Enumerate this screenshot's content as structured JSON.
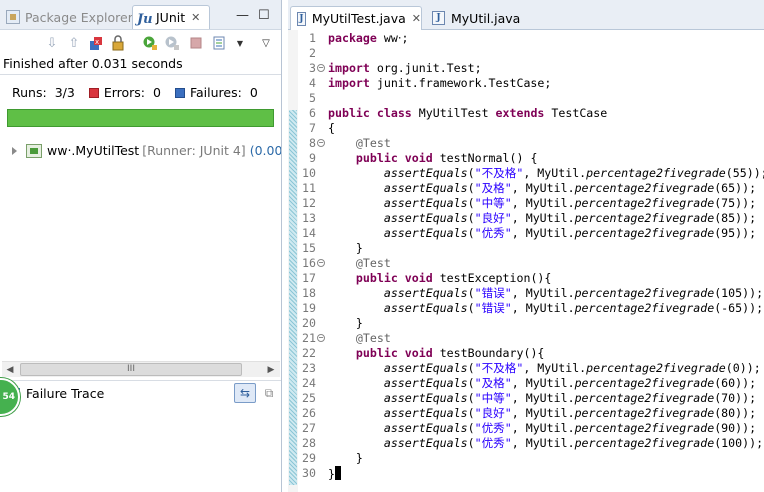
{
  "left_panel": {
    "tabs": [
      {
        "label": "Package Explorer",
        "icon": "package-explorer-icon"
      },
      {
        "label": "JUnit",
        "icon": "junit-icon",
        "close": "✕"
      }
    ],
    "minimize": "—",
    "maximize": "☐",
    "status": "Finished after 0.031 seconds",
    "counters": {
      "runs_label": "Runs:",
      "runs_value": "3/3",
      "errors_label": "Errors:",
      "errors_value": "0",
      "failures_label": "Failures:",
      "failures_value": "0"
    },
    "progress": {
      "fraction": 1.0,
      "color": "#5fbf46"
    },
    "tree": {
      "test_name": "ww‧.MyUtilTest",
      "runner": "[Runner: JUnit 4]",
      "time": "(0.00)"
    },
    "scrollbar_grip": "III",
    "failure_trace_label": "Failure Trace",
    "badge_text": "54"
  },
  "editor": {
    "tabs": [
      {
        "label": "MyUtilTest.java",
        "close": "✕",
        "active": true
      },
      {
        "label": "MyUtil.java",
        "active": false
      }
    ],
    "lines": [
      {
        "n": "1",
        "text": "package ww‧;"
      },
      {
        "n": "2",
        "text": ""
      },
      {
        "n": "3",
        "text": "import org.junit.Test;"
      },
      {
        "n": "4",
        "text": "import junit.framework.TestCase;"
      },
      {
        "n": "5",
        "text": ""
      },
      {
        "n": "6",
        "text": "public class MyUtilTest extends TestCase"
      },
      {
        "n": "7",
        "text": "{"
      },
      {
        "n": "8",
        "text": "    @Test"
      },
      {
        "n": "9",
        "text": "    public void testNormal() {"
      },
      {
        "n": "10",
        "text": "        assertEquals(\"不及格\", MyUtil.percentage2fivegrade(55));"
      },
      {
        "n": "11",
        "text": "        assertEquals(\"及格\", MyUtil.percentage2fivegrade(65));"
      },
      {
        "n": "12",
        "text": "        assertEquals(\"中等\", MyUtil.percentage2fivegrade(75));"
      },
      {
        "n": "13",
        "text": "        assertEquals(\"良好\", MyUtil.percentage2fivegrade(85));"
      },
      {
        "n": "14",
        "text": "        assertEquals(\"优秀\", MyUtil.percentage2fivegrade(95));"
      },
      {
        "n": "15",
        "text": "    }"
      },
      {
        "n": "16",
        "text": "    @Test"
      },
      {
        "n": "17",
        "text": "    public void testException(){"
      },
      {
        "n": "18",
        "text": "        assertEquals(\"错误\", MyUtil.percentage2fivegrade(105));"
      },
      {
        "n": "19",
        "text": "        assertEquals(\"错误\", MyUtil.percentage2fivegrade(-65));"
      },
      {
        "n": "20",
        "text": "    }"
      },
      {
        "n": "21",
        "text": "    @Test"
      },
      {
        "n": "22",
        "text": "    public void testBoundary(){"
      },
      {
        "n": "23",
        "text": "        assertEquals(\"不及格\", MyUtil.percentage2fivegrade(0));"
      },
      {
        "n": "24",
        "text": "        assertEquals(\"及格\", MyUtil.percentage2fivegrade(60));"
      },
      {
        "n": "25",
        "text": "        assertEquals(\"中等\", MyUtil.percentage2fivegrade(70));"
      },
      {
        "n": "26",
        "text": "        assertEquals(\"良好\", MyUtil.percentage2fivegrade(80));"
      },
      {
        "n": "27",
        "text": "        assertEquals(\"优秀\", MyUtil.percentage2fivegrade(90));"
      },
      {
        "n": "28",
        "text": "        assertEquals(\"优秀\", MyUtil.percentage2fivegrade(100));"
      },
      {
        "n": "29",
        "text": "    }"
      },
      {
        "n": "30",
        "text": "}"
      }
    ]
  }
}
